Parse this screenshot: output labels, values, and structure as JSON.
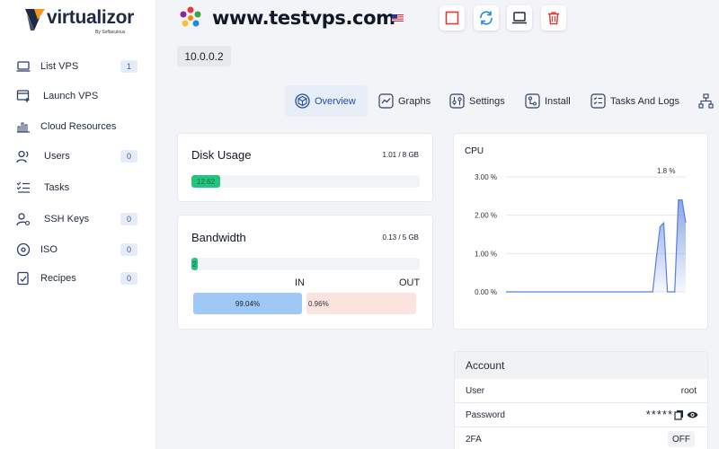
{
  "app": {
    "logo_text": "virtualizor",
    "logo_sub": "By Softaculous"
  },
  "sidebar": {
    "items": [
      {
        "label": "List VPS",
        "icon": "laptop-icon",
        "badge": "1"
      },
      {
        "label": "Launch VPS",
        "icon": "launch-icon",
        "badge": ""
      },
      {
        "label": "Cloud Resources",
        "icon": "bar-chart-icon",
        "badge": ""
      },
      {
        "label": "Users",
        "icon": "users-icon",
        "badge": "0"
      },
      {
        "label": "Tasks",
        "icon": "tasks-icon",
        "badge": ""
      },
      {
        "label": "SSH Keys",
        "icon": "key-user-icon",
        "badge": "0"
      },
      {
        "label": "ISO",
        "icon": "disc-icon",
        "badge": "0"
      },
      {
        "label": "Recipes",
        "icon": "recipe-icon",
        "badge": "0"
      }
    ]
  },
  "header": {
    "hostname": "www.testvps.com",
    "ip": "10.0.0.2",
    "actions": [
      "stop-icon",
      "restart-icon",
      "console-icon",
      "trash-icon"
    ]
  },
  "tabs": [
    {
      "label": "Overview",
      "icon": "cube-icon",
      "active": true
    },
    {
      "label": "Graphs",
      "icon": "graph-icon",
      "active": false
    },
    {
      "label": "Settings",
      "icon": "sliders-icon",
      "active": false
    },
    {
      "label": "Install",
      "icon": "install-icon",
      "active": false
    },
    {
      "label": "Tasks And Logs",
      "icon": "checklist-icon",
      "active": false
    }
  ],
  "disk": {
    "title": "Disk Usage",
    "used": "1.01 / 8 GB",
    "percent_label": "12.62",
    "percent": 12.62
  },
  "bandwidth": {
    "title": "Bandwidth",
    "used": "0.13 / 5 GB",
    "percent_label": "2",
    "percent": 2.6,
    "in_label": "IN",
    "out_label": "OUT",
    "in_value": "99.04%",
    "out_value": "0.96%"
  },
  "cpu": {
    "title": "CPU",
    "current": "1.8 %",
    "ticks": [
      "3.00 %",
      "2.00 %",
      "1.00 %",
      "0.00 %"
    ]
  },
  "chart_data": {
    "type": "area",
    "title": "CPU",
    "ylim": [
      0,
      3
    ],
    "yticks": [
      0,
      1,
      2,
      3
    ],
    "values": [
      0,
      0,
      0,
      0,
      0,
      0,
      0,
      0,
      0,
      0,
      0,
      0,
      0,
      0,
      0,
      0,
      0,
      0,
      0,
      0,
      0,
      0,
      0,
      0,
      0,
      0,
      0,
      0,
      0,
      0,
      0,
      0,
      0,
      0,
      0,
      0,
      0,
      0,
      0,
      0,
      0,
      0.9,
      1.7,
      1.8,
      0,
      0,
      0,
      2.4,
      2.4,
      1.8
    ],
    "annotation": "1.8 %"
  },
  "account": {
    "title": "Account",
    "user_label": "User",
    "user_value": "root",
    "password_label": "Password",
    "password_value": "*****",
    "twofa_label": "2FA",
    "twofa_value": "OFF"
  },
  "colors": {
    "accent": "#1e4fa6",
    "success": "#23c47e",
    "danger": "#e53935",
    "chart_line": "#5b7fdc"
  }
}
